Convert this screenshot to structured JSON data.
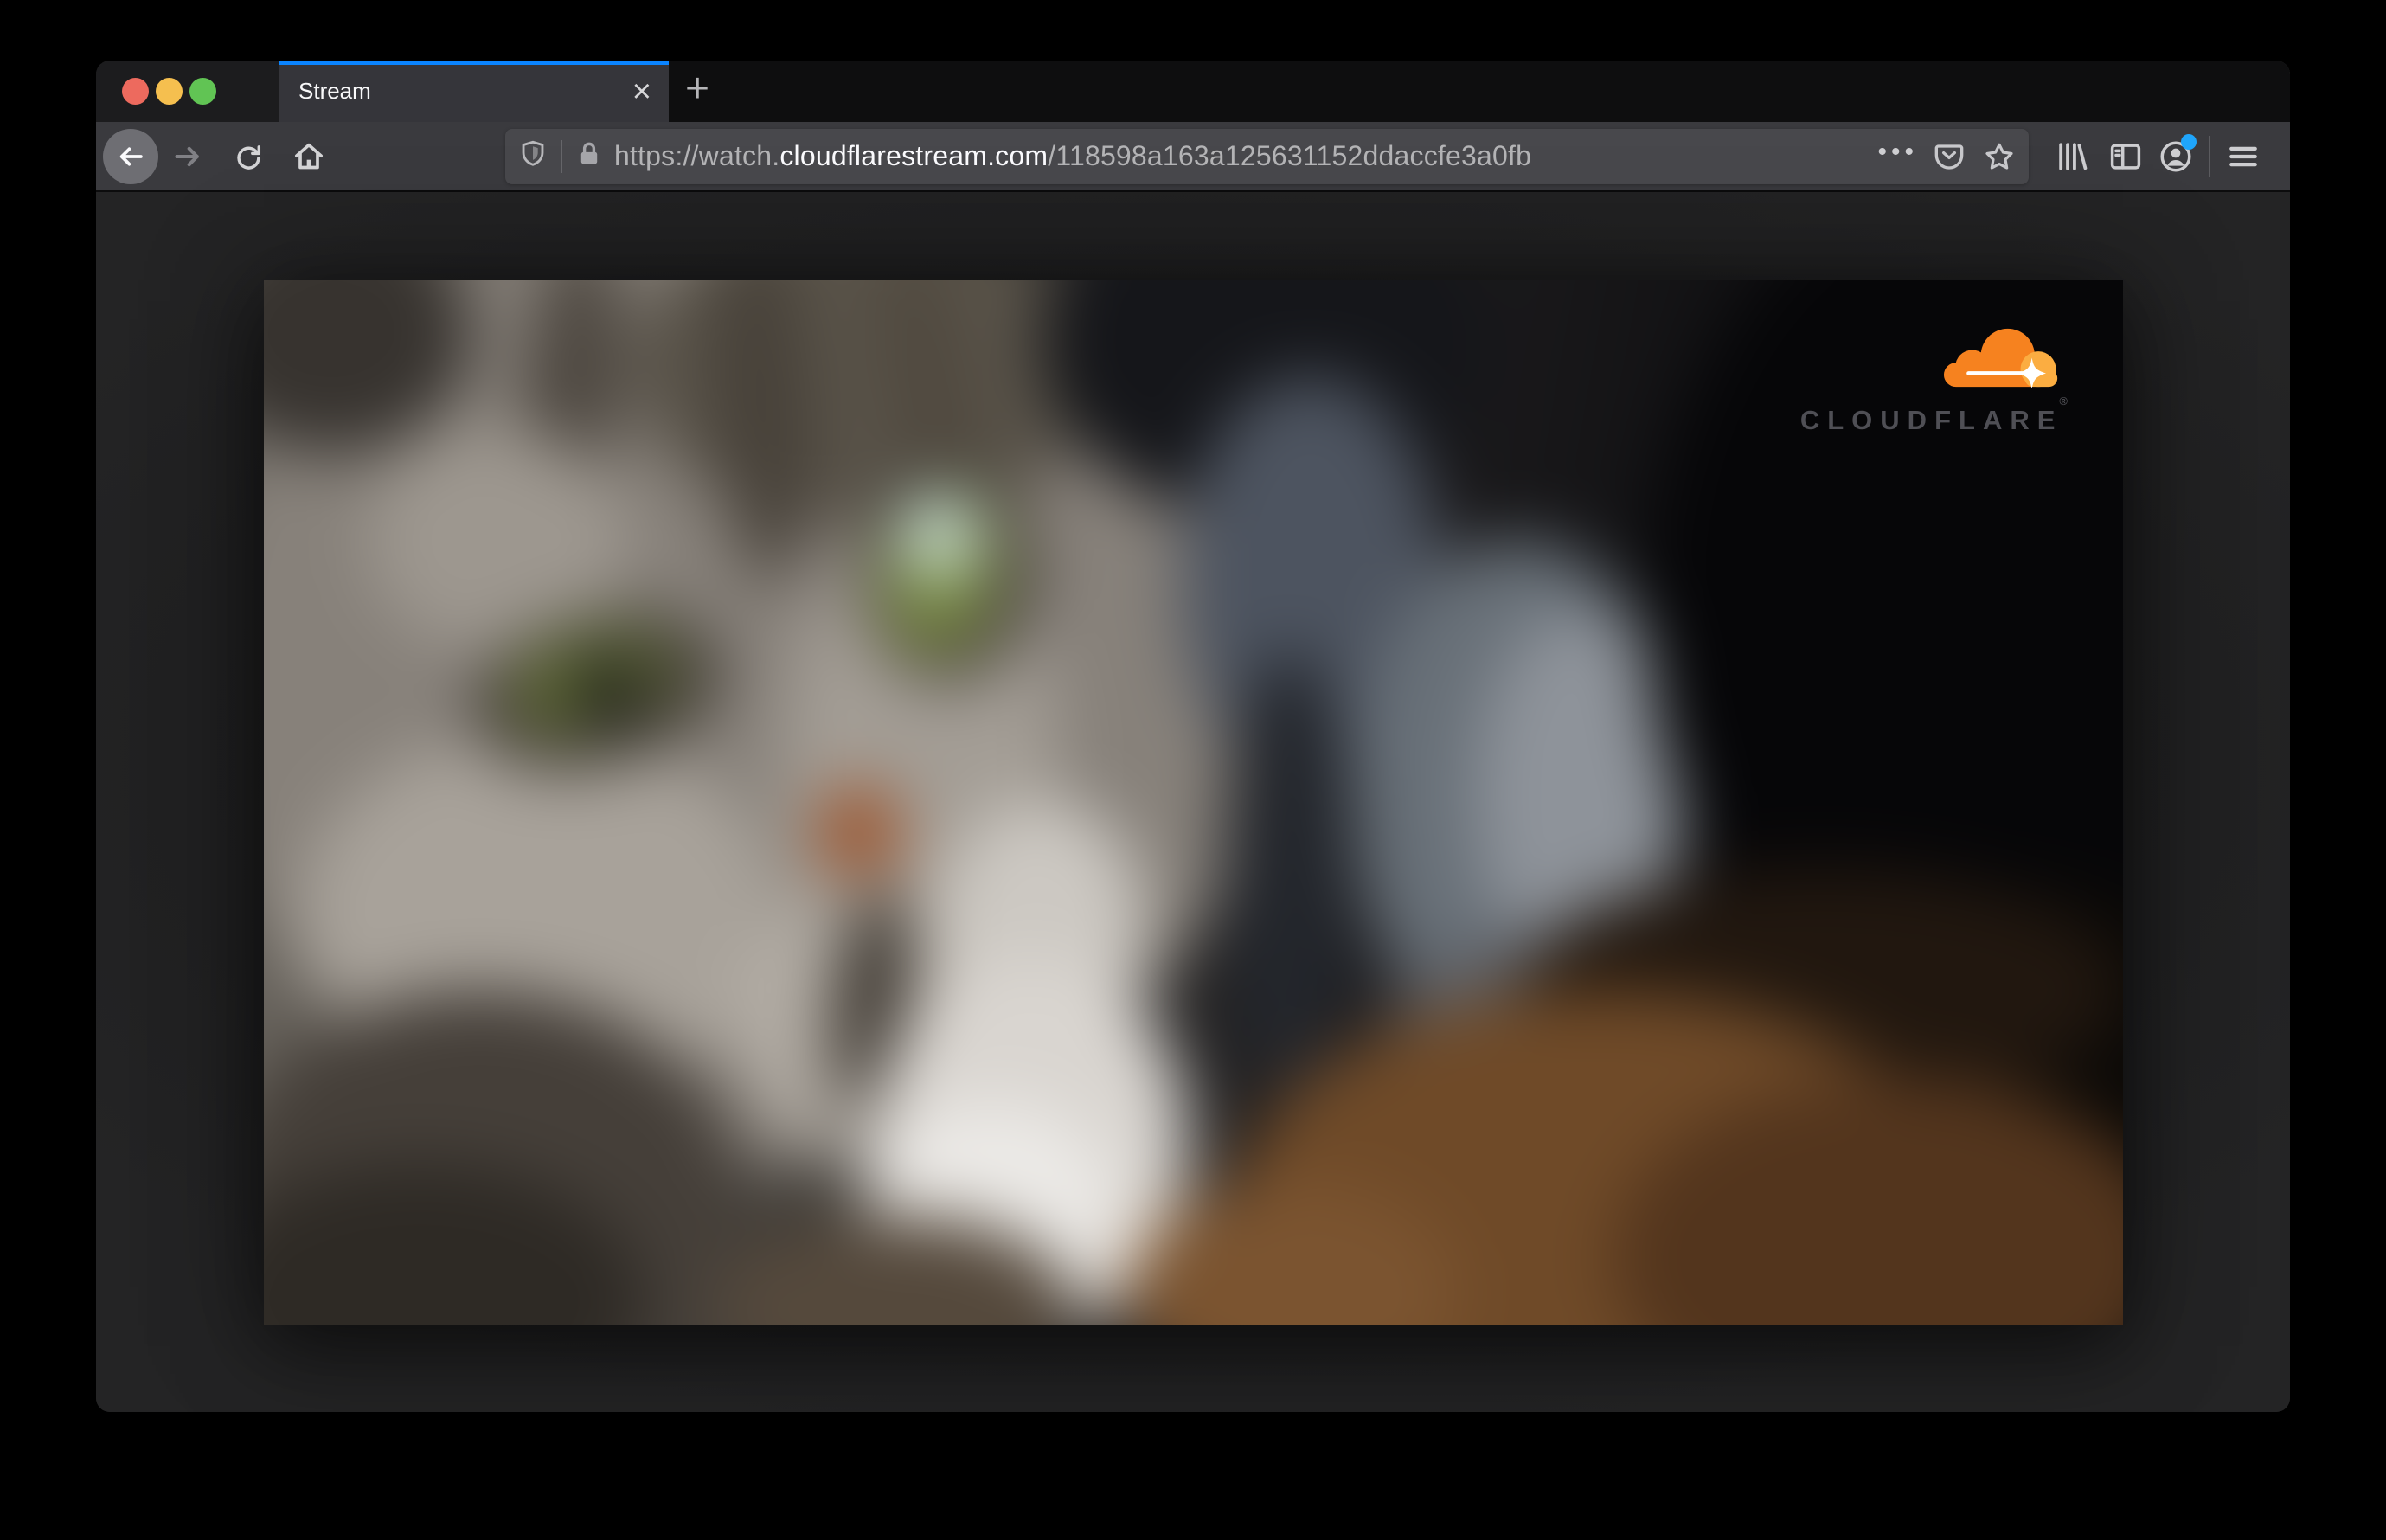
{
  "browser": {
    "window_controls": [
      {
        "name": "close",
        "color": "#ed6a5e"
      },
      {
        "name": "minimize",
        "color": "#f5bf4f"
      },
      {
        "name": "zoom",
        "color": "#61c454"
      }
    ],
    "tab_bar": {
      "active_tab": {
        "title": "Stream",
        "close_glyph": "×",
        "accent_color": "#0a84ff"
      },
      "new_tab_glyph": "+"
    },
    "toolbar": {
      "url_bar": {
        "prefix": "https://watch.",
        "domain": "cloudflarestream.com",
        "path": "/118598a163a125631152ddaccfe3a0fb",
        "page_actions_glyph": "•••"
      },
      "account_notification_color": "#1fa5fb"
    }
  },
  "video_player": {
    "watermark": {
      "brand": "CLOUDFLARE",
      "registered_mark": "®",
      "cloud_color": "#f6821f",
      "cloud_highlight_color": "#fbad41",
      "sparkle_color": "#ffffff"
    }
  }
}
